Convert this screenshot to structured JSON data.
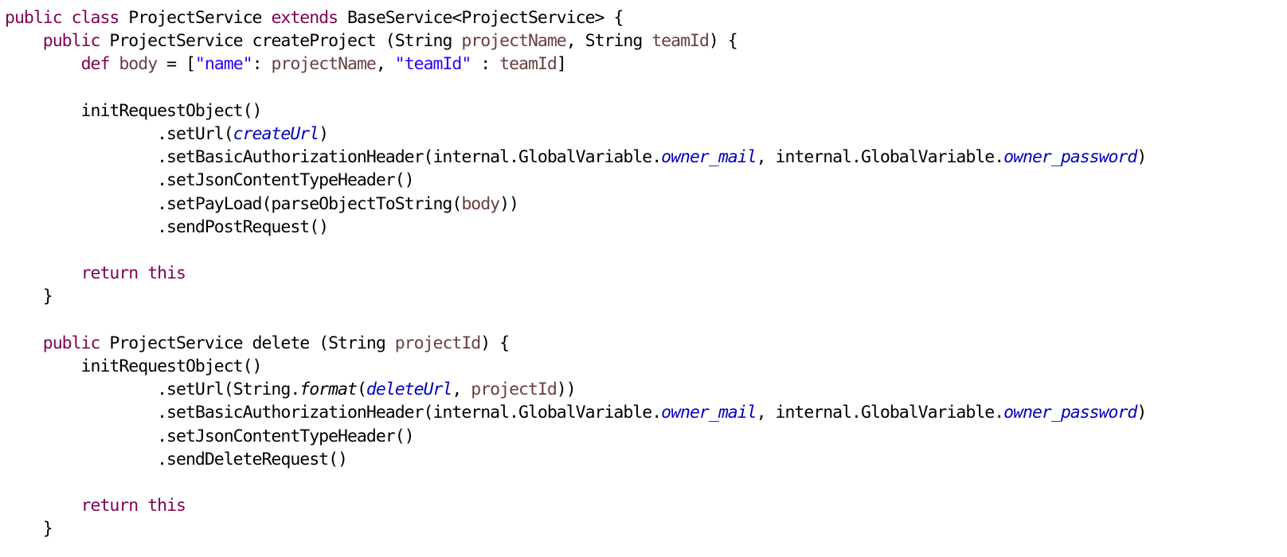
{
  "colors": {
    "background": "#ffffff",
    "keyword": "#7f0055",
    "variable": "#6a3e3e",
    "string": "#2a00ff",
    "field": "#0000c0",
    "plain": "#000000"
  },
  "code": {
    "lines": [
      [
        {
          "t": "public class",
          "k": "keyword"
        },
        {
          "t": " ProjectService ",
          "k": "plain"
        },
        {
          "t": "extends",
          "k": "keyword"
        },
        {
          "t": " BaseService<ProjectService> {",
          "k": "plain"
        }
      ],
      [
        {
          "t": "    ",
          "k": "plain"
        },
        {
          "t": "public",
          "k": "keyword"
        },
        {
          "t": " ProjectService createProject (String ",
          "k": "plain"
        },
        {
          "t": "projectName",
          "k": "variable"
        },
        {
          "t": ", String ",
          "k": "plain"
        },
        {
          "t": "teamId",
          "k": "variable"
        },
        {
          "t": ") {",
          "k": "plain"
        }
      ],
      [
        {
          "t": "        ",
          "k": "plain"
        },
        {
          "t": "def",
          "k": "keyword"
        },
        {
          "t": " ",
          "k": "plain"
        },
        {
          "t": "body",
          "k": "variable"
        },
        {
          "t": " = [",
          "k": "plain"
        },
        {
          "t": "\"name\"",
          "k": "string"
        },
        {
          "t": ": ",
          "k": "plain"
        },
        {
          "t": "projectName",
          "k": "variable"
        },
        {
          "t": ", ",
          "k": "plain"
        },
        {
          "t": "\"teamId\"",
          "k": "string"
        },
        {
          "t": " : ",
          "k": "plain"
        },
        {
          "t": "teamId",
          "k": "variable"
        },
        {
          "t": "]",
          "k": "plain"
        }
      ],
      [],
      [
        {
          "t": "        initRequestObject()",
          "k": "plain"
        }
      ],
      [
        {
          "t": "                .setUrl(",
          "k": "plain"
        },
        {
          "t": "createUrl",
          "k": "field"
        },
        {
          "t": ")",
          "k": "plain"
        }
      ],
      [
        {
          "t": "                .setBasicAuthorizationHeader(internal.GlobalVariable.",
          "k": "plain"
        },
        {
          "t": "owner_mail",
          "k": "field"
        },
        {
          "t": ", internal.GlobalVariable.",
          "k": "plain"
        },
        {
          "t": "owner_password",
          "k": "field"
        },
        {
          "t": ")",
          "k": "plain"
        }
      ],
      [
        {
          "t": "                .setJsonContentTypeHeader()",
          "k": "plain"
        }
      ],
      [
        {
          "t": "                .setPayLoad(parseObjectToString(",
          "k": "plain"
        },
        {
          "t": "body",
          "k": "variable"
        },
        {
          "t": "))",
          "k": "plain"
        }
      ],
      [
        {
          "t": "                .sendPostRequest()",
          "k": "plain"
        }
      ],
      [],
      [
        {
          "t": "        ",
          "k": "plain"
        },
        {
          "t": "return",
          "k": "keyword"
        },
        {
          "t": " ",
          "k": "plain"
        },
        {
          "t": "this",
          "k": "keyword"
        }
      ],
      [
        {
          "t": "    }",
          "k": "plain"
        }
      ],
      [],
      [
        {
          "t": "    ",
          "k": "plain"
        },
        {
          "t": "public",
          "k": "keyword"
        },
        {
          "t": " ProjectService delete (String ",
          "k": "plain"
        },
        {
          "t": "projectId",
          "k": "variable"
        },
        {
          "t": ") {",
          "k": "plain"
        }
      ],
      [
        {
          "t": "        initRequestObject()",
          "k": "plain"
        }
      ],
      [
        {
          "t": "                .setUrl(String.",
          "k": "plain"
        },
        {
          "t": "format",
          "k": "static"
        },
        {
          "t": "(",
          "k": "plain"
        },
        {
          "t": "deleteUrl",
          "k": "field"
        },
        {
          "t": ", ",
          "k": "plain"
        },
        {
          "t": "projectId",
          "k": "variable"
        },
        {
          "t": "))",
          "k": "plain"
        }
      ],
      [
        {
          "t": "                .setBasicAuthorizationHeader(internal.GlobalVariable.",
          "k": "plain"
        },
        {
          "t": "owner_mail",
          "k": "field"
        },
        {
          "t": ", internal.GlobalVariable.",
          "k": "plain"
        },
        {
          "t": "owner_password",
          "k": "field"
        },
        {
          "t": ")",
          "k": "plain"
        }
      ],
      [
        {
          "t": "                .setJsonContentTypeHeader()",
          "k": "plain"
        }
      ],
      [
        {
          "t": "                .sendDeleteRequest()",
          "k": "plain"
        }
      ],
      [],
      [
        {
          "t": "        ",
          "k": "plain"
        },
        {
          "t": "return",
          "k": "keyword"
        },
        {
          "t": " ",
          "k": "plain"
        },
        {
          "t": "this",
          "k": "keyword"
        }
      ],
      [
        {
          "t": "    }",
          "k": "plain"
        }
      ]
    ]
  }
}
